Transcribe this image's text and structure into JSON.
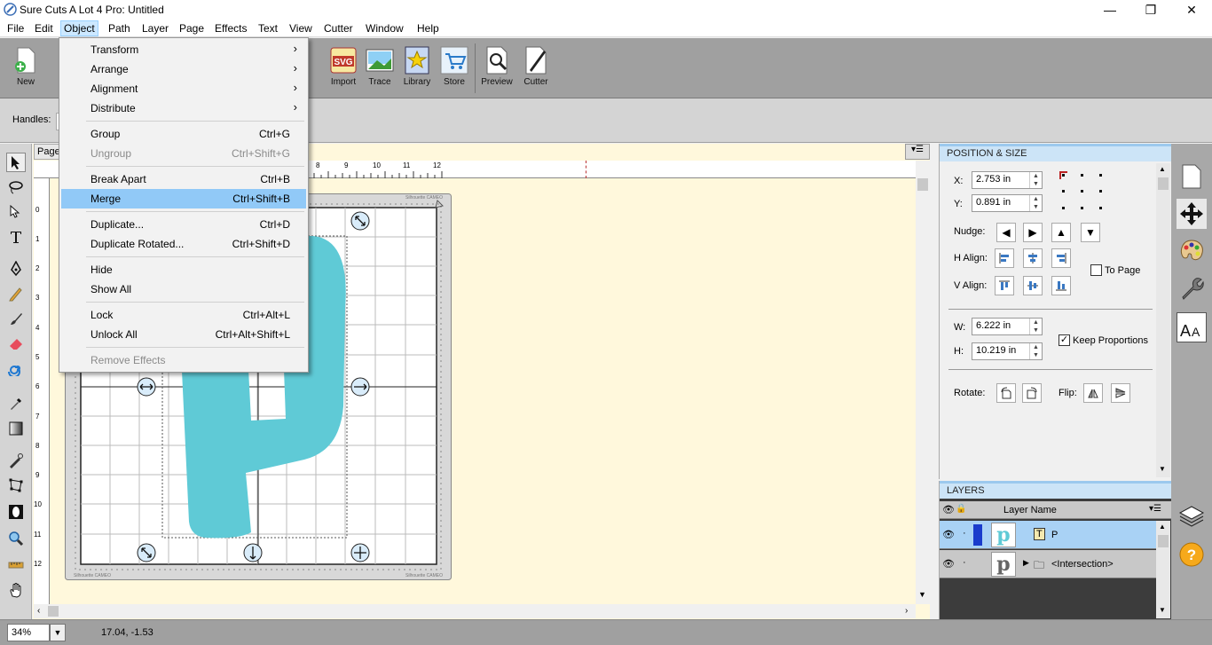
{
  "window": {
    "title": "Sure Cuts A Lot 4 Pro: Untitled",
    "minimize": "—",
    "maximize": "❐",
    "close": "✕"
  },
  "menubar": [
    {
      "label": "File"
    },
    {
      "label": "Edit"
    },
    {
      "label": "Object"
    },
    {
      "label": "Path"
    },
    {
      "label": "Layer"
    },
    {
      "label": "Page"
    },
    {
      "label": "Effects"
    },
    {
      "label": "Text"
    },
    {
      "label": "View"
    },
    {
      "label": "Cutter"
    },
    {
      "label": "Window"
    },
    {
      "label": "Help"
    }
  ],
  "toolbar": [
    {
      "label": "New",
      "icon": "new-document-icon"
    },
    {
      "label": "Import",
      "icon": "svg-import-icon"
    },
    {
      "label": "Trace",
      "icon": "trace-image-icon"
    },
    {
      "label": "Library",
      "icon": "library-star-icon"
    },
    {
      "label": "Store",
      "icon": "store-cart-icon"
    },
    {
      "label": "Preview",
      "icon": "preview-magnifier-icon"
    },
    {
      "label": "Cutter",
      "icon": "cutter-knife-icon"
    }
  ],
  "handles": {
    "label": "Handles:"
  },
  "page_tab": "Page",
  "object_menu": [
    {
      "label": "Transform",
      "shortcut": "",
      "submenu": true,
      "disabled": false
    },
    {
      "label": "Arrange",
      "shortcut": "",
      "submenu": true,
      "disabled": false
    },
    {
      "label": "Alignment",
      "shortcut": "",
      "submenu": true,
      "disabled": false
    },
    {
      "label": "Distribute",
      "shortcut": "",
      "submenu": true,
      "disabled": false
    },
    {
      "label": "Group",
      "shortcut": "Ctrl+G",
      "submenu": false,
      "disabled": false
    },
    {
      "label": "Ungroup",
      "shortcut": "Ctrl+Shift+G",
      "submenu": false,
      "disabled": true
    },
    {
      "label": "Break Apart",
      "shortcut": "Ctrl+B",
      "submenu": false,
      "disabled": false
    },
    {
      "label": "Merge",
      "shortcut": "Ctrl+Shift+B",
      "submenu": false,
      "disabled": false,
      "highlighted": true
    },
    {
      "label": "Duplicate...",
      "shortcut": "Ctrl+D",
      "submenu": false,
      "disabled": false
    },
    {
      "label": "Duplicate Rotated...",
      "shortcut": "Ctrl+Shift+D",
      "submenu": false,
      "disabled": false
    },
    {
      "label": "Hide",
      "shortcut": "",
      "submenu": false,
      "disabled": false
    },
    {
      "label": "Show All",
      "shortcut": "",
      "submenu": false,
      "disabled": false
    },
    {
      "label": "Lock",
      "shortcut": "Ctrl+Alt+L",
      "submenu": false,
      "disabled": false
    },
    {
      "label": "Unlock All",
      "shortcut": "Ctrl+Alt+Shift+L",
      "submenu": false,
      "disabled": false
    },
    {
      "label": "Remove Effects",
      "shortcut": "",
      "submenu": false,
      "disabled": true
    }
  ],
  "ruler_top": [
    "8",
    "9",
    "10",
    "11",
    "12"
  ],
  "ruler_left": [
    "0",
    "1",
    "2",
    "3",
    "4",
    "5",
    "6",
    "7",
    "8",
    "9",
    "10",
    "11",
    "12"
  ],
  "mat_label": "Silhouette CAMEO",
  "position_size": {
    "header": "POSITION & SIZE",
    "x_label": "X:",
    "x_value": "2.753 in",
    "y_label": "Y:",
    "y_value": "0.891 in",
    "nudge_label": "Nudge:",
    "halign_label": "H Align:",
    "valign_label": "V Align:",
    "to_page_label": "To Page",
    "to_page_checked": false,
    "w_label": "W:",
    "w_value": "6.222 in",
    "h_label": "H:",
    "h_value": "10.219 in",
    "keep_proportions_label": "Keep Proportions",
    "keep_proportions_checked": true,
    "rotate_label": "Rotate:",
    "flip_label": "Flip:"
  },
  "layers": {
    "header": "LAYERS",
    "column_name": "Layer Name",
    "rows": [
      {
        "name": "P",
        "selected": true
      },
      {
        "name": "<Intersection>",
        "selected": false
      }
    ]
  },
  "statusbar": {
    "zoom": "34%",
    "coords": "17.04, -1.53"
  },
  "colors": {
    "shape_fill": "#5fcad6",
    "accent": "#91c9f7",
    "canvas_bg": "#fff8dc"
  }
}
